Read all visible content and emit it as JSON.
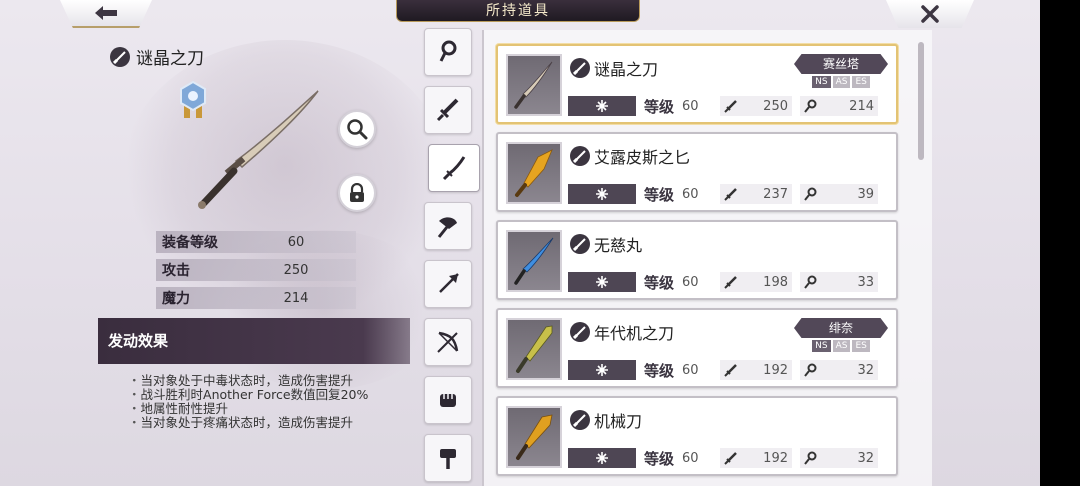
{
  "header": {
    "title": "所持道具"
  },
  "selected_item": {
    "name": "谜晶之刀",
    "stats": [
      {
        "label": "装备等级",
        "value": "60"
      },
      {
        "label": "攻击",
        "value": "250"
      },
      {
        "label": "魔力",
        "value": "214"
      }
    ],
    "effect_title": "发动效果",
    "effects": [
      "当对象处于中毒状态时，造成伤害提升",
      "战斗胜利时Another Force数值回复20%",
      "地属性耐性提升",
      "当对象处于疼痛状态时，造成伤害提升"
    ]
  },
  "category_tabs": [
    "accessory-icon",
    "sword-icon",
    "katana-icon",
    "axe-icon",
    "spear-icon",
    "bow-icon",
    "fist-icon",
    "hammer-icon"
  ],
  "items": [
    {
      "name": "谜晶之刀",
      "level_label": "等级",
      "level": "60",
      "attack": "250",
      "magic": "214",
      "character": "赛丝塔",
      "styles": [
        "NS",
        "AS",
        "ES"
      ],
      "active_style": "NS",
      "blade_color": "#d8ccb8"
    },
    {
      "name": "艾露皮斯之匕",
      "level_label": "等级",
      "level": "60",
      "attack": "237",
      "magic": "39",
      "character": "",
      "styles": [],
      "blade_color": "#e6a420"
    },
    {
      "name": "无慈丸",
      "level_label": "等级",
      "level": "60",
      "attack": "198",
      "magic": "33",
      "character": "",
      "styles": [],
      "blade_color": "#3f8ee0"
    },
    {
      "name": "年代机之刀",
      "level_label": "等级",
      "level": "60",
      "attack": "192",
      "magic": "32",
      "character": "绯奈",
      "styles": [
        "NS",
        "AS",
        "ES"
      ],
      "active_style": "NS",
      "blade_color": "#c8c04a"
    },
    {
      "name": "机械刀",
      "level_label": "等级",
      "level": "60",
      "attack": "192",
      "magic": "32",
      "character": "",
      "styles": [],
      "blade_color": "#e0a020"
    }
  ]
}
